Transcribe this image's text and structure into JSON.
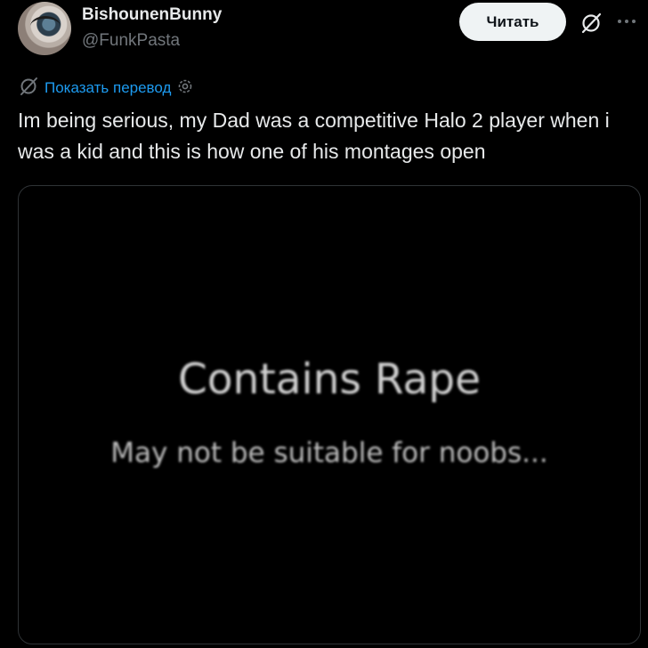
{
  "author": {
    "display_name": "BishounenBunny",
    "handle": "@FunkPasta"
  },
  "actions": {
    "follow_label": "Читать",
    "grok_icon": "grok-slash-icon",
    "more_icon": "more-horizontal-icon"
  },
  "translate": {
    "label": "Показать перевод",
    "icons": [
      "grok-slash-icon",
      "gear-icon"
    ]
  },
  "tweet": {
    "text": "Im being serious, my Dad was a competitive Halo 2 player when i was a kid and this is how one of his montages open"
  },
  "media": {
    "title": "Contains Rape",
    "subtitle": "May not be suitable for noobs..."
  },
  "colors": {
    "background": "#000000",
    "text": "#e7e9ea",
    "secondary": "#71767b",
    "link": "#1d9bf0",
    "button_bg": "#eff3f4",
    "border": "#2f3336"
  }
}
